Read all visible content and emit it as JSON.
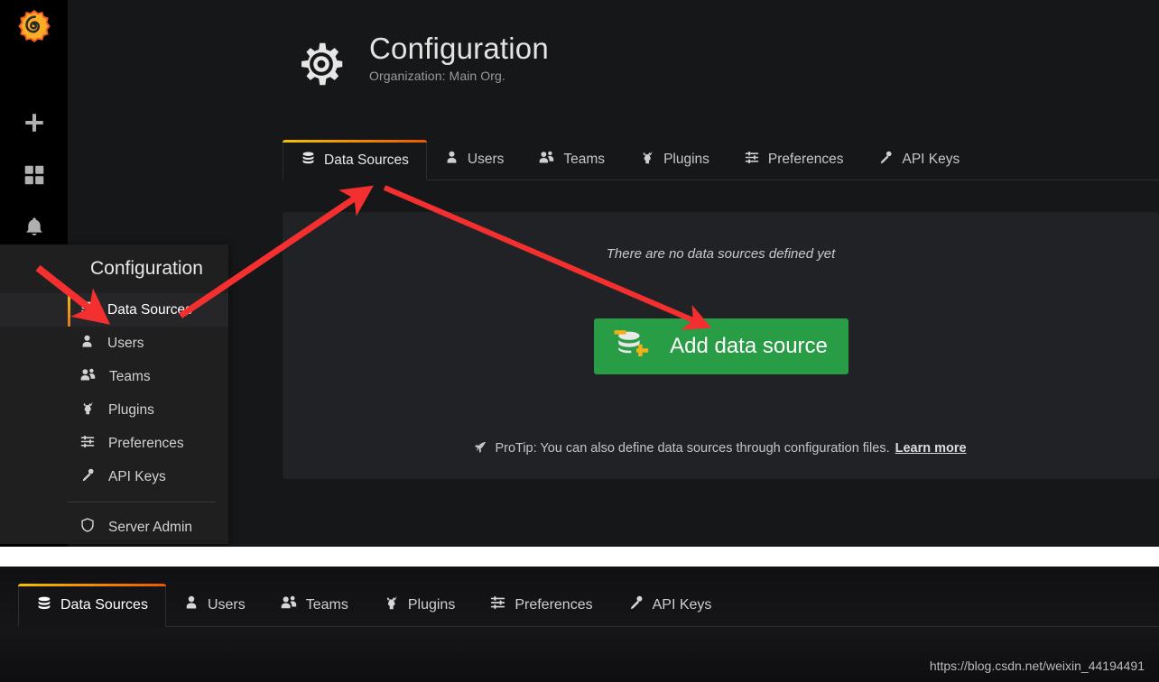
{
  "sidebar": {
    "logo_icon": "grafana-logo-icon",
    "items": [
      {
        "icon": "plus-icon",
        "name": "create"
      },
      {
        "icon": "dashboards-icon",
        "name": "dashboards"
      },
      {
        "icon": "bell-icon",
        "name": "alerting"
      },
      {
        "icon": "gear-icon",
        "name": "configuration",
        "active": true
      }
    ]
  },
  "header": {
    "icon": "gear-icon",
    "title": "Configuration",
    "subtitle": "Organization: Main Org."
  },
  "tabs": [
    {
      "label": "Data Sources",
      "icon": "database-icon",
      "active": true
    },
    {
      "label": "Users",
      "icon": "user-icon",
      "active": false
    },
    {
      "label": "Teams",
      "icon": "users-icon",
      "active": false
    },
    {
      "label": "Plugins",
      "icon": "plugin-icon",
      "active": false
    },
    {
      "label": "Preferences",
      "icon": "sliders-icon",
      "active": false
    },
    {
      "label": "API Keys",
      "icon": "key-icon",
      "active": false
    }
  ],
  "content": {
    "empty_message": "There are no data sources defined yet",
    "add_button_label": "Add data source",
    "add_button_icon": "database-plus-icon",
    "add_button_color": "#299c46",
    "protip_icon": "rocket-icon",
    "protip_text": "ProTip: You can also define data sources through configuration files.",
    "protip_link": "Learn more"
  },
  "flyout": {
    "title": "Configuration",
    "title_icon": "gear-icon",
    "items": [
      {
        "label": "Data Sources",
        "icon": "database-icon",
        "active": true
      },
      {
        "label": "Users",
        "icon": "user-icon",
        "active": false
      },
      {
        "label": "Teams",
        "icon": "users-icon",
        "active": false
      },
      {
        "label": "Plugins",
        "icon": "plugin-icon",
        "active": false
      },
      {
        "label": "Preferences",
        "icon": "sliders-icon",
        "active": false
      },
      {
        "label": "API Keys",
        "icon": "key-icon",
        "active": false
      }
    ],
    "footer_item": {
      "label": "Server Admin",
      "icon": "shield-icon"
    }
  },
  "annotations": {
    "arrow_color": "#f42f2f",
    "count": 3
  },
  "bottom_tabs": [
    {
      "label": "Data Sources",
      "icon": "database-icon",
      "active": true
    },
    {
      "label": "Users",
      "icon": "user-icon",
      "active": false
    },
    {
      "label": "Teams",
      "icon": "users-icon",
      "active": false
    },
    {
      "label": "Plugins",
      "icon": "plugin-icon",
      "active": false
    },
    {
      "label": "Preferences",
      "icon": "sliders-icon",
      "active": false
    },
    {
      "label": "API Keys",
      "icon": "key-icon",
      "active": false
    }
  ],
  "watermark": "https://blog.csdn.net/weixin_44194491"
}
